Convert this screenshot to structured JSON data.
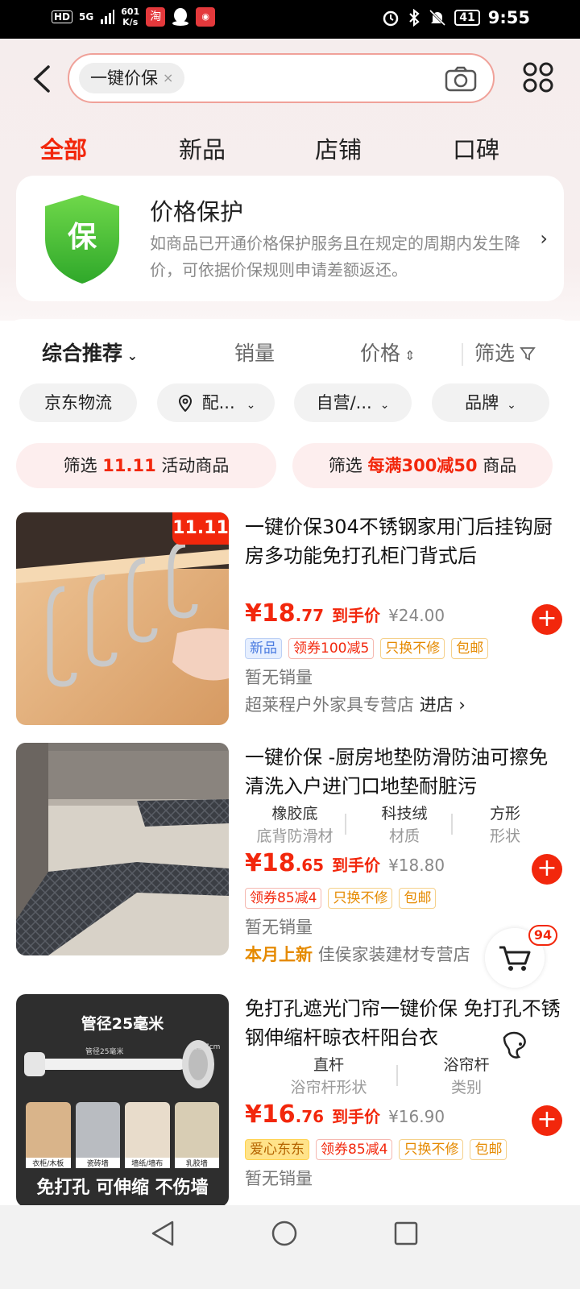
{
  "status_bar": {
    "hd": "HD",
    "net_5g": "5G",
    "speed_value": "601",
    "speed_unit": "K/s",
    "time": "9:55",
    "battery": "41",
    "app_taobao": "淘"
  },
  "header": {
    "search_chip": "一键价保",
    "chip_close": "×"
  },
  "tabs": [
    "全部",
    "新品",
    "店铺",
    "口碑"
  ],
  "protect": {
    "icon_text": "保",
    "title": "价格保护",
    "desc": "如商品已开通价格保护服务且在规定的周期内发生降价，可依据价保规则申请差额返还。",
    "chevron": "›"
  },
  "sort": {
    "comprehensive": "综合推荐",
    "sales": "销量",
    "price": "价格",
    "filter": "筛选"
  },
  "pills": [
    "京东物流",
    "配...",
    "自营/...",
    "品牌"
  ],
  "banners": {
    "b1_prefix": "筛选",
    "b1_logo": "11.11",
    "b1_suffix": "活动商品",
    "b2_prefix": "筛选",
    "b2_promo": "每满300减50",
    "b2_suffix": "商品"
  },
  "products": [
    {
      "title": "一键价保304不锈钢家用门后挂钩厨房多功能免打孔柜门背式后",
      "badge": "11.11",
      "price_int": "¥18",
      "price_dec": ".77",
      "price_label": "到手价",
      "orig": "¥24.00",
      "tags": [
        "新品",
        "领券100减5",
        "只换不修",
        "包邮"
      ],
      "sales": "暂无销量",
      "shop": "超莱程户外家具专营店",
      "enter": "进店 ›"
    },
    {
      "title": "一键价保 -厨房地垫防滑防油可擦免清洗入户进门口地垫耐脏污",
      "attrs": [
        {
          "v": "橡胶底",
          "k": "底背防滑材"
        },
        {
          "v": "科技绒",
          "k": "材质"
        },
        {
          "v": "方形",
          "k": "形状"
        }
      ],
      "price_int": "¥18",
      "price_dec": ".65",
      "price_label": "到手价",
      "orig": "¥18.80",
      "tags": [
        "领券85减4",
        "只换不修",
        "包邮"
      ],
      "sales": "暂无销量",
      "shop_hl": "本月上新",
      "shop": "佳侯家装建材专营店"
    },
    {
      "title": "免打孔遮光门帘一键价保 免打孔不锈钢伸缩杆晾衣杆阳台衣",
      "img_title": "管径25毫米",
      "img_sub": "管径25毫米",
      "img_dim": "直径7cm",
      "img_labels": [
        "衣柜/木板",
        "瓷砖墙",
        "墙纸/墙布",
        "乳胶墙"
      ],
      "img_footer": "免打孔 可伸缩 不伤墙",
      "attrs": [
        {
          "v": "直杆",
          "k": "浴帘杆形状"
        },
        {
          "v": "浴帘杆",
          "k": "类别"
        }
      ],
      "price_int": "¥16",
      "price_dec": ".76",
      "price_label": "到手价",
      "orig": "¥16.90",
      "tags": [
        "爱心东东",
        "领券85减4",
        "只换不修",
        "包邮"
      ],
      "sales": "暂无销量"
    }
  ],
  "float": {
    "cart_count": "94"
  },
  "colors": {
    "accent": "#f2270c",
    "shield_green": "#4cc232"
  }
}
